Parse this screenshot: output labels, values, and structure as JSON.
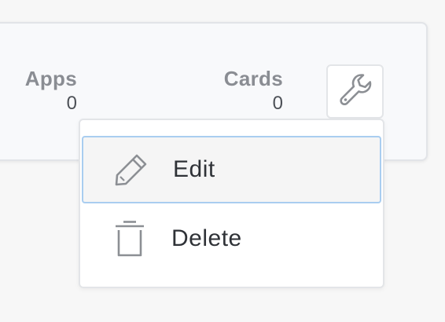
{
  "stats": {
    "apps": {
      "label": "Apps",
      "value": "0"
    },
    "cards": {
      "label": "Cards",
      "value": "0"
    }
  },
  "toolbar": {
    "settings_icon": "wrench-icon"
  },
  "menu": {
    "items": [
      {
        "label": "Edit",
        "icon": "pencil-icon",
        "state": "highlighted"
      },
      {
        "label": "Delete",
        "icon": "trash-icon",
        "state": "default"
      }
    ]
  },
  "colors": {
    "highlight_border": "#a9cdf0",
    "icon_gray": "#8c8f94",
    "text_dark": "#2f3237"
  }
}
